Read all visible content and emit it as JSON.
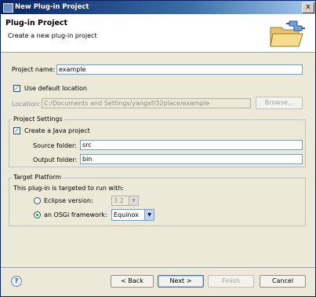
{
  "window": {
    "title": "New Plug-in Project",
    "controls": {
      "close": "x"
    }
  },
  "header": {
    "title": "Plug-in Project",
    "description": "Create a new plug-in project"
  },
  "project_name": {
    "label": "Project name:",
    "value": "example"
  },
  "default_location": {
    "label": "Use default location",
    "checked": true
  },
  "location": {
    "label": "Location:",
    "value": "C:/Documents and Settings/yangxf/32place/example",
    "browse_label": "Browse..."
  },
  "project_settings": {
    "title": "Project Settings",
    "java_project": {
      "label": "Create a Java project",
      "checked": true
    },
    "source_folder": {
      "label": "Source folder:",
      "value": "src"
    },
    "output_folder": {
      "label": "Output folder:",
      "value": "bin"
    }
  },
  "target_platform": {
    "title": "Target Platform",
    "description": "This plug-in is targeted to run with:",
    "eclipse": {
      "label": "Eclipse version:",
      "value": "3.2",
      "selected": false
    },
    "osgi": {
      "label": "an OSGi framework:",
      "value": "Equinox",
      "selected": true
    }
  },
  "footer": {
    "help_icon": "question-mark-icon",
    "back_label": "< Back",
    "next_label": "Next >",
    "finish_label": "Finish",
    "cancel_label": "Cancel"
  },
  "colors": {
    "title_bar": "#0a246a",
    "dialog_bg": "#ece9d8",
    "field_border": "#7f9db9",
    "check_mark": "#21a121"
  }
}
